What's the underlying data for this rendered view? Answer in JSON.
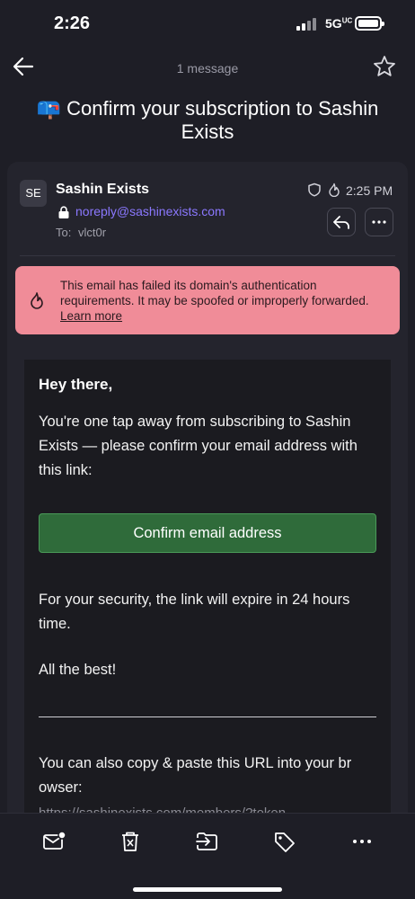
{
  "status_bar": {
    "time": "2:26",
    "network": "5G",
    "network_suffix": "UC"
  },
  "header": {
    "message_count": "1 message",
    "subject_emoji": "📪",
    "subject": "Confirm your subscription to Sashin Exists"
  },
  "message": {
    "avatar_initials": "SE",
    "sender_name": "Sashin Exists",
    "sender_email": "noreply@sashinexists.com",
    "to_label": "To:",
    "to_value": "vlct0r",
    "time": "2:25 PM"
  },
  "warning": {
    "text": "This email has failed its domain's authentication requirements. It may be spoofed or improperly forwarded.",
    "link": "Learn more"
  },
  "email_body": {
    "greeting": "Hey there,",
    "intro": "You're one tap away from subscribing to Sashin Exists — please confirm your email address with this link:",
    "confirm_button": "Confirm email address",
    "security_note": "For your security, the link will expire in 24 hours time.",
    "signoff": "All the best!",
    "copy_url_line1": "You can also copy & paste this URL into your br",
    "copy_url_line2": "owser:",
    "url_partial": "https://sashinexists.com/members/?token"
  },
  "toolbar": {
    "items": [
      "mark-unread",
      "trash",
      "move",
      "label",
      "more"
    ]
  },
  "colors": {
    "background": "#1e1e26",
    "card": "#24242d",
    "accent_link": "#8b78ff",
    "warning_bg": "#f08c98",
    "confirm_button": "#2f6b3a"
  }
}
